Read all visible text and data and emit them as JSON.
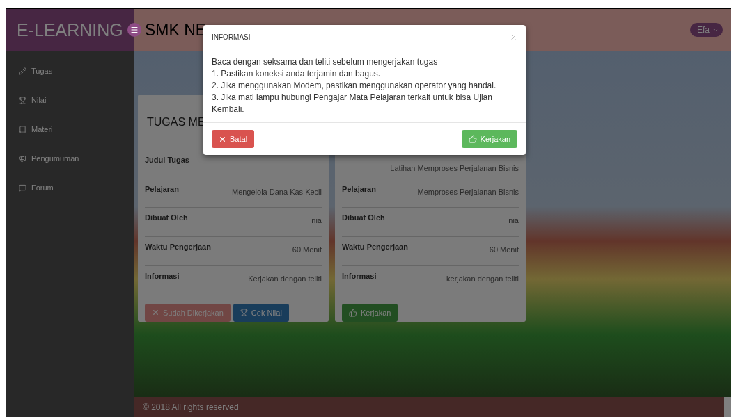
{
  "header": {
    "brand": "E-LEARNING",
    "title": "SMK NE",
    "user": "Efa"
  },
  "sidebar": {
    "items": [
      {
        "label": "Tugas"
      },
      {
        "label": "Nilai"
      },
      {
        "label": "Materi"
      },
      {
        "label": "Pengumuman"
      },
      {
        "label": "Forum"
      }
    ]
  },
  "cards": [
    {
      "title": "TUGAS ME",
      "rows": [
        {
          "label": "Judul Tugas"
        },
        {
          "label": "Pelajaran",
          "value": "Mengelola Dana Kas Kecil"
        },
        {
          "label": "Dibuat Oleh",
          "value": "nia"
        },
        {
          "label": "Waktu Pengerjaan",
          "value": "60 Menit"
        },
        {
          "label": "Informasi",
          "value": "Kerjakan dengan teliti"
        }
      ],
      "buttons": [
        {
          "kind": "done",
          "label": "Sudah Dikerjakan",
          "disabled": true
        },
        {
          "kind": "score",
          "label": "Cek Nilai",
          "disabled": false
        }
      ]
    },
    {
      "rows": [
        {
          "value": "Latihan Memproses Perjalanan Bisnis"
        },
        {
          "label": "Pelajaran",
          "value": "Memproses Perjalanan Bisnis"
        },
        {
          "label": "Dibuat Oleh",
          "value": "nia"
        },
        {
          "label": "Waktu Pengerjaan",
          "value": "60 Menit"
        },
        {
          "label": "Informasi",
          "value": "kerjakan dengan teliti"
        }
      ],
      "buttons": [
        {
          "kind": "start",
          "label": "Kerjakan",
          "disabled": false
        }
      ]
    }
  ],
  "footer": "© 2018 All rights reserved",
  "modal": {
    "title": "INFORMASI",
    "lines": [
      "Baca dengan seksama dan teliti sebelum mengerjakan tugas",
      "1. Pastikan koneksi anda terjamin dan bagus.",
      "2. Jika menggunakan Modem, pastikan menggunakan operator yang handal.",
      "3. Jika mati lampu hubungi Pengajar Mata Pelajaran terkait untuk bisa Ujian Kembali."
    ],
    "buttons": [
      {
        "kind": "cancel",
        "label": "Batal"
      },
      {
        "kind": "proceed",
        "label": "Kerjakan"
      }
    ]
  }
}
